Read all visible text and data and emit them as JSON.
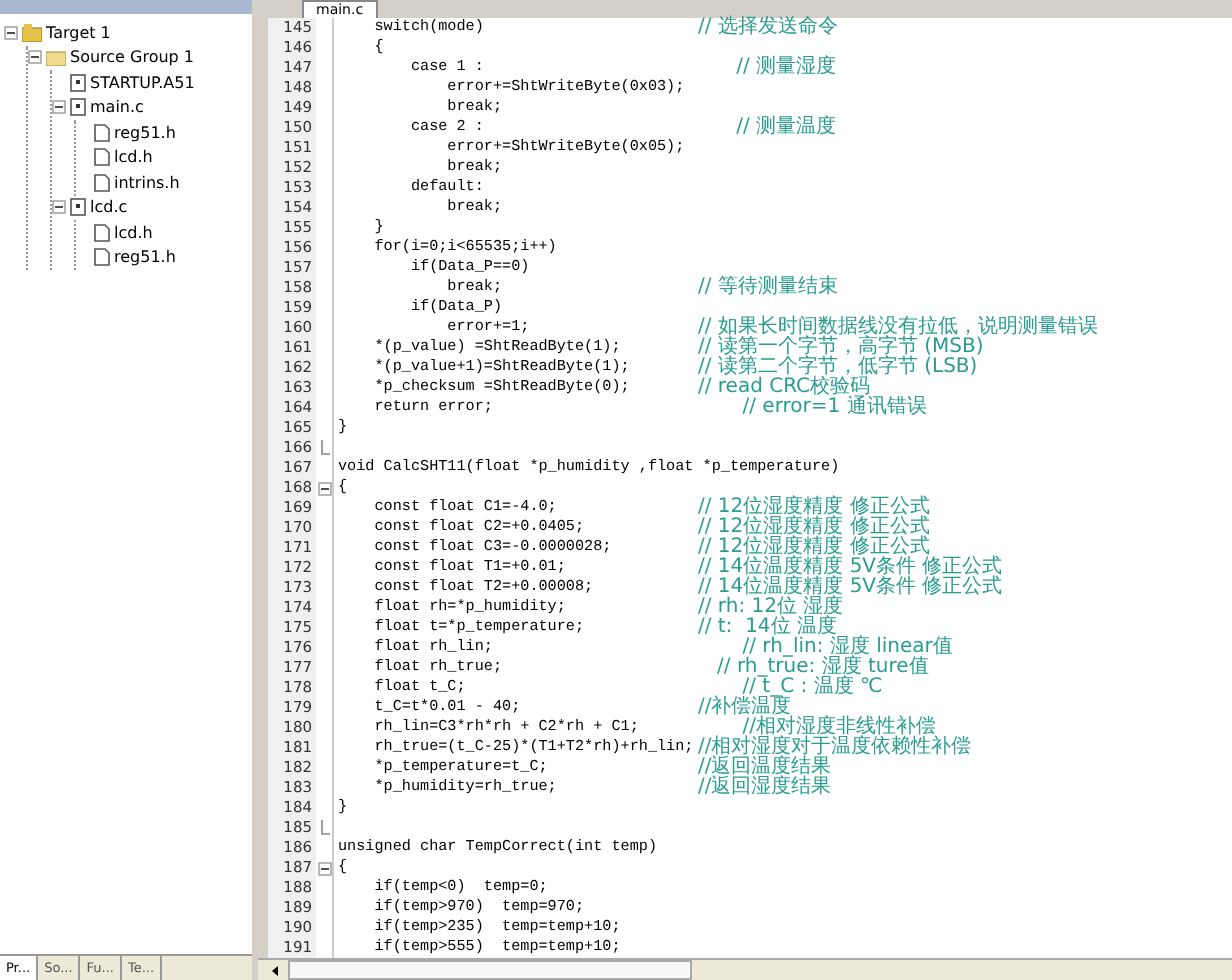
{
  "project_tree": [
    {
      "label": "Target 1",
      "kind": "target",
      "expanded": true,
      "children": [
        {
          "label": "Source Group 1",
          "kind": "folder",
          "expanded": true,
          "children": [
            {
              "label": "STARTUP.A51",
              "kind": "source"
            },
            {
              "label": "main.c",
              "kind": "source",
              "expanded": true,
              "children": [
                {
                  "label": "reg51.h",
                  "kind": "header"
                },
                {
                  "label": "lcd.h",
                  "kind": "header"
                },
                {
                  "label": "intrins.h",
                  "kind": "header"
                }
              ]
            },
            {
              "label": "lcd.c",
              "kind": "source",
              "expanded": true,
              "children": [
                {
                  "label": "lcd.h",
                  "kind": "header"
                },
                {
                  "label": "reg51.h",
                  "kind": "header"
                }
              ]
            }
          ]
        }
      ]
    }
  ],
  "panel_tabs": [
    {
      "label": "Pr...",
      "selected": true
    },
    {
      "label": "So...",
      "selected": false
    },
    {
      "label": "Fu...",
      "selected": false
    },
    {
      "label": "Te...",
      "selected": false
    }
  ],
  "editor_tab": {
    "label": "main.c"
  },
  "lines": [
    {
      "number": "145",
      "code": "    switch(mode)",
      "comment": "// 选择发送命令"
    },
    {
      "number": "146",
      "code": "    {"
    },
    {
      "number": "147",
      "code": "        case 1 :",
      "comment": "      // 测量湿度"
    },
    {
      "number": "148",
      "code": "            error+=ShtWriteByte(0x03);"
    },
    {
      "number": "149",
      "code": "            break;"
    },
    {
      "number": "150",
      "code": "        case 2 :",
      "comment": "      // 测量温度"
    },
    {
      "number": "151",
      "code": "            error+=ShtWriteByte(0x05);"
    },
    {
      "number": "152",
      "code": "            break;"
    },
    {
      "number": "153",
      "code": "        default:"
    },
    {
      "number": "154",
      "code": "            break;"
    },
    {
      "number": "155",
      "code": "    }"
    },
    {
      "number": "156",
      "code": "    for(i=0;i<65535;i++)"
    },
    {
      "number": "157",
      "code": "        if(Data_P==0)"
    },
    {
      "number": "158",
      "code": "            break;",
      "comment": "// 等待测量结束"
    },
    {
      "number": "159",
      "code": "        if(Data_P)"
    },
    {
      "number": "160",
      "code": "            error+=1;",
      "comment": "// 如果长时间数据线没有拉低，说明测量错误"
    },
    {
      "number": "161",
      "code": "    *(p_value) =ShtReadByte(1);",
      "comment": "// 读第一个字节，高字节 (MSB)"
    },
    {
      "number": "162",
      "code": "    *(p_value+1)=ShtReadByte(1);",
      "comment": "// 读第二个字节，低字节 (LSB)"
    },
    {
      "number": "163",
      "code": "    *p_checksum =ShtReadByte(0);",
      "comment": "// read CRC校验码"
    },
    {
      "number": "164",
      "code": "    return error;",
      "comment": "       // error=1 通讯错误"
    },
    {
      "number": "165",
      "code": "}"
    },
    {
      "number": "166",
      "kind": "fold_end"
    },
    {
      "number": "167",
      "code": "void CalcSHT11(float *p_humidity ,float *p_temperature)"
    },
    {
      "number": "168",
      "code": "{",
      "kind": "fold_start"
    },
    {
      "number": "169",
      "code": "    const float C1=-4.0;",
      "comment": "// 12位湿度精度 修正公式"
    },
    {
      "number": "170",
      "code": "    const float C2=+0.0405;",
      "comment": "// 12位湿度精度 修正公式"
    },
    {
      "number": "171",
      "code": "    const float C3=-0.0000028;",
      "comment": "// 12位湿度精度 修正公式"
    },
    {
      "number": "172",
      "code": "    const float T1=+0.01;",
      "comment": "// 14位温度精度 5V条件 修正公式"
    },
    {
      "number": "173",
      "code": "    const float T2=+0.00008;",
      "comment": "// 14位温度精度 5V条件 修正公式"
    },
    {
      "number": "174",
      "code": "    float rh=*p_humidity;",
      "comment": "// rh: 12位 湿度"
    },
    {
      "number": "175",
      "code": "    float t=*p_temperature;",
      "comment": "// t:  14位 温度"
    },
    {
      "number": "176",
      "code": "    float rh_lin;",
      "comment": "       // rh_lin: 湿度 linear值"
    },
    {
      "number": "177",
      "code": "    float rh_true;",
      "comment": "   // rh_true: 湿度 ture值"
    },
    {
      "number": "178",
      "code": "    float t_C;",
      "comment": "       // t_C : 温度 ℃"
    },
    {
      "number": "179",
      "code": "    t_C=t*0.01 - 40;",
      "comment": "//补偿温度"
    },
    {
      "number": "180",
      "code": "    rh_lin=C3*rh*rh + C2*rh + C1;",
      "comment": "       //相对湿度非线性补偿"
    },
    {
      "number": "181",
      "code": "    rh_true=(t_C-25)*(T1+T2*rh)+rh_lin;",
      "comment": "//相对湿度对于温度依赖性补偿"
    },
    {
      "number": "182",
      "code": "    *p_temperature=t_C;",
      "comment": "//返回温度结果"
    },
    {
      "number": "183",
      "code": "    *p_humidity=rh_true;",
      "comment": "//返回湿度结果"
    },
    {
      "number": "184",
      "code": "}"
    },
    {
      "number": "185",
      "kind": "fold_end"
    },
    {
      "number": "186",
      "code": "unsigned char TempCorrect(int temp)"
    },
    {
      "number": "187",
      "code": "{",
      "kind": "fold_start"
    },
    {
      "number": "188",
      "code": "    if(temp<0)  temp=0;"
    },
    {
      "number": "189",
      "code": "    if(temp>970)  temp=970;"
    },
    {
      "number": "190",
      "code": "    if(temp>235)  temp=temp+10;"
    },
    {
      "number": "191",
      "code": "    if(temp>555)  temp=temp+10;"
    }
  ]
}
